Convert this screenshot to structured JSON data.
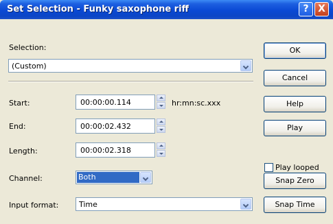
{
  "window": {
    "title": "Set Selection - Funky saxophone riff",
    "help_glyph": "?",
    "close_glyph": "X"
  },
  "selection": {
    "label": "Selection:",
    "value": "(Custom)"
  },
  "start": {
    "label": "Start:",
    "value": "00:00:00.114",
    "format_hint": "hr:mn:sc.xxx"
  },
  "end": {
    "label": "End:",
    "value": "00:00:02.432"
  },
  "length": {
    "label": "Length:",
    "value": "00:00:02.318"
  },
  "channel": {
    "label": "Channel:",
    "value": "Both"
  },
  "input_format": {
    "label": "Input format:",
    "value": "Time"
  },
  "buttons": {
    "ok": "OK",
    "cancel": "Cancel",
    "help": "Help",
    "play": "Play",
    "snap_zero": "Snap Zero",
    "snap_time": "Snap Time"
  },
  "play_looped": {
    "label": "Play looped",
    "checked": false
  },
  "colors": {
    "title_bar": "#0a49d4",
    "dialog_bg": "#ece9d8",
    "highlight": "#316ac5"
  }
}
